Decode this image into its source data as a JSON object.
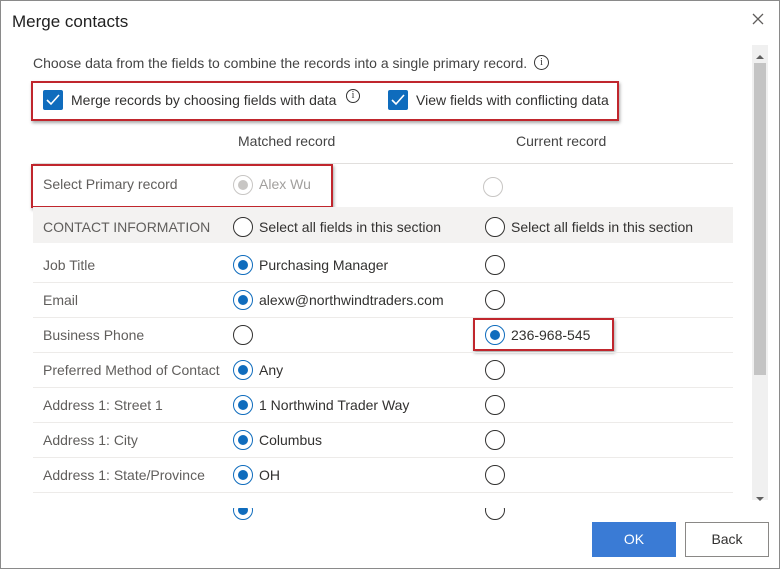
{
  "dialog": {
    "title": "Merge contacts",
    "description": "Choose data from the fields to combine the records into a single primary record."
  },
  "options": {
    "merge_label": "Merge records by choosing fields with data",
    "merge_checked": true,
    "conflict_label": "View fields with conflicting data",
    "conflict_checked": true
  },
  "columns": {
    "matched": "Matched record",
    "current": "Current record"
  },
  "primary": {
    "label": "Select Primary record",
    "matched_value": "Alex Wu",
    "selected": "matched"
  },
  "section": {
    "title": "CONTACT INFORMATION",
    "select_all_matched": "Select all fields in this section",
    "select_all_current": "Select all fields in this section"
  },
  "fields": [
    {
      "label": "Job Title",
      "matched": "Purchasing Manager",
      "current": "",
      "selected": "matched"
    },
    {
      "label": "Email",
      "matched": "alexw@northwindtraders.com",
      "current": "",
      "selected": "matched"
    },
    {
      "label": "Business Phone",
      "matched": "",
      "current": "236-968-545",
      "selected": "current"
    },
    {
      "label": "Preferred Method of Contact",
      "matched": "Any",
      "current": "",
      "selected": "matched"
    },
    {
      "label": "Address 1: Street 1",
      "matched": "1 Northwind Trader Way",
      "current": "",
      "selected": "matched"
    },
    {
      "label": "Address 1: City",
      "matched": "Columbus",
      "current": "",
      "selected": "matched"
    },
    {
      "label": "Address 1: State/Province",
      "matched": "OH",
      "current": "",
      "selected": "matched"
    }
  ],
  "buttons": {
    "ok": "OK",
    "back": "Back"
  },
  "icons": {
    "close": "close-icon",
    "info": "info-icon",
    "check": "checkmark-icon",
    "scroll_up": "scroll-up-arrow-icon",
    "scroll_down": "scroll-down-arrow-icon"
  },
  "colors": {
    "accent": "#0f6cbd",
    "highlight_box": "#c0262d",
    "ok_button": "#3a7bd5"
  }
}
